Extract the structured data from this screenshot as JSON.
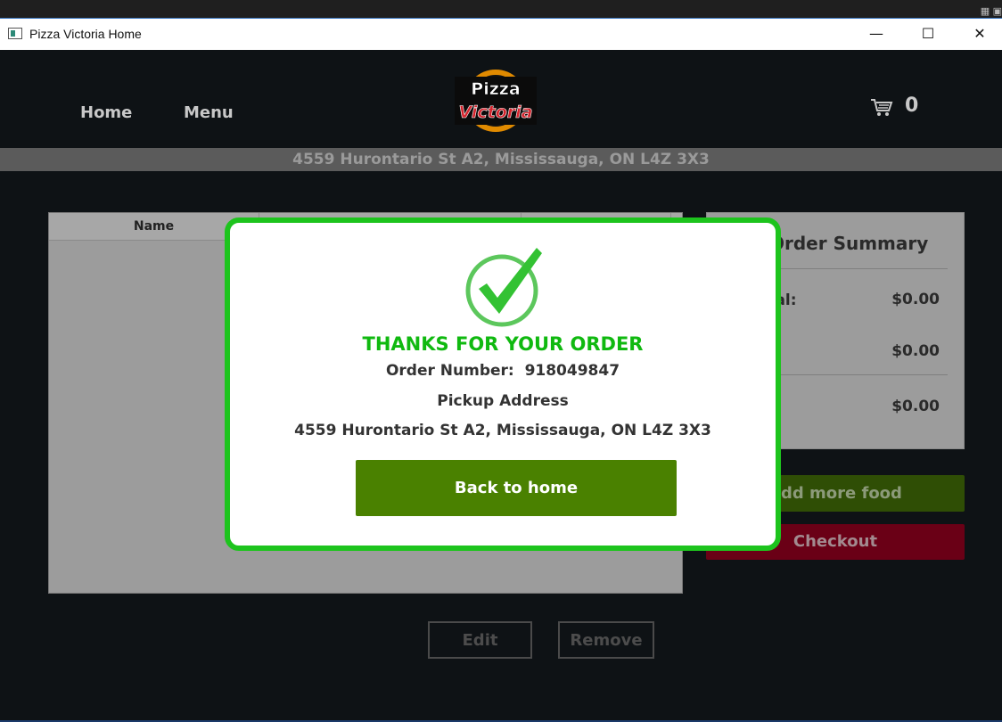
{
  "window": {
    "title": "Pizza Victoria Home",
    "minimize": "—",
    "maximize": "☐",
    "close": "✕"
  },
  "nav": {
    "home": "Home",
    "menu": "Menu",
    "cart_count": "0"
  },
  "logo": {
    "line1": "Pizza",
    "line2": "Victoria"
  },
  "address_bar": "4559 Hurontario St A2, Mississauga, ON L4Z 3X3",
  "table": {
    "columns": [
      "Name",
      "",
      ""
    ]
  },
  "summary": {
    "title": "Order Summary",
    "rows": [
      {
        "label": "Subtotal:",
        "value": "$0.00"
      },
      {
        "label": "",
        "value": "$0.00"
      },
      {
        "label": "",
        "value": "$0.00"
      }
    ]
  },
  "buttons": {
    "add_more": "Add more food",
    "checkout": "Checkout",
    "edit": "Edit",
    "remove": "Remove"
  },
  "modal": {
    "heading": "THANKS FOR YOUR ORDER",
    "order_number_label": "Order Number:",
    "order_number": "918049847",
    "pickup_label": "Pickup Address",
    "pickup_address": "4559 Hurontario St A2, Mississauga, ON L4Z 3X3",
    "back_button": "Back to home"
  },
  "colors": {
    "modal_border": "#1dc41d",
    "thanks_text": "#10b910",
    "back_button": "#4a8100",
    "add_more_button": "#2f4e05",
    "checkout_button": "#6a0016"
  }
}
